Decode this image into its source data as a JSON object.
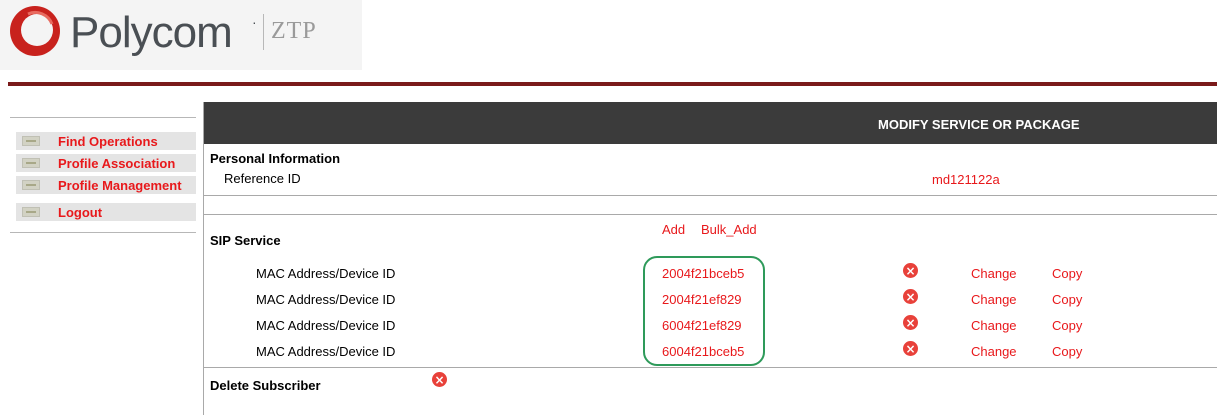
{
  "header": {
    "brand": "Polycom",
    "trademark": "·",
    "product": "ZTP"
  },
  "nav": {
    "items": [
      {
        "label": "Find Operations"
      },
      {
        "label": "Profile Association"
      },
      {
        "label": "Profile Management"
      },
      {
        "label": "Logout"
      }
    ]
  },
  "main": {
    "title": "MODIFY SERVICE OR PACKAGE",
    "personal": {
      "heading": "Personal Information",
      "reference_label": "Reference ID",
      "reference_value": "md121122a"
    },
    "sip": {
      "heading": "SIP Service",
      "add_label": "Add",
      "bulk_add_label": "Bulk_Add",
      "devices": [
        {
          "label": "MAC Address/Device ID",
          "value": "2004f21bceb5",
          "change": "Change",
          "copy": "Copy"
        },
        {
          "label": "MAC Address/Device ID",
          "value": "2004f21ef829",
          "change": "Change",
          "copy": "Copy"
        },
        {
          "label": "MAC Address/Device ID",
          "value": "6004f21ef829",
          "change": "Change",
          "copy": "Copy"
        },
        {
          "label": "MAC Address/Device ID",
          "value": "6004f21bceb5",
          "change": "Change",
          "copy": "Copy"
        }
      ]
    },
    "delete_subscriber_label": "Delete Subscriber"
  },
  "icons": {
    "delete": "x-circle-icon",
    "nav": "key-icon"
  },
  "colors": {
    "accent_red": "#e8181b",
    "header_rule": "#7a1a1a",
    "bar": "#3b3b3b",
    "highlight": "#2e9a5a"
  }
}
